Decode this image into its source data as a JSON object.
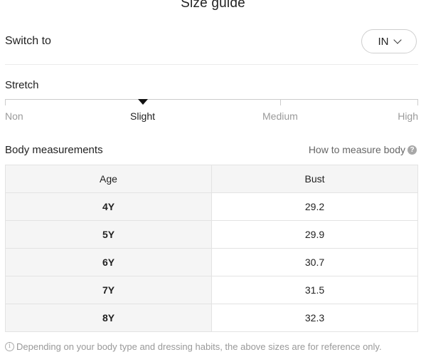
{
  "header": {
    "title": "Size guide"
  },
  "switch": {
    "label": "Switch to",
    "unit": "IN",
    "icon": "chevron-down-icon"
  },
  "stretch": {
    "label": "Stretch",
    "levels": [
      "Non",
      "Slight",
      "Medium",
      "High"
    ],
    "selected": "Slight",
    "selected_index": 1
  },
  "body_measurements": {
    "label": "Body measurements",
    "how_to_link": "How to measure body",
    "help_icon": "question-circle-icon"
  },
  "table": {
    "headers": [
      "Age",
      "Bust"
    ],
    "rows": [
      [
        "4Y",
        "29.2"
      ],
      [
        "5Y",
        "29.9"
      ],
      [
        "6Y",
        "30.7"
      ],
      [
        "7Y",
        "31.5"
      ],
      [
        "8Y",
        "32.3"
      ]
    ]
  },
  "footnote": {
    "icon": "info-circle-icon",
    "text": "Depending on your body type and dressing habits, the above sizes are for reference only."
  }
}
